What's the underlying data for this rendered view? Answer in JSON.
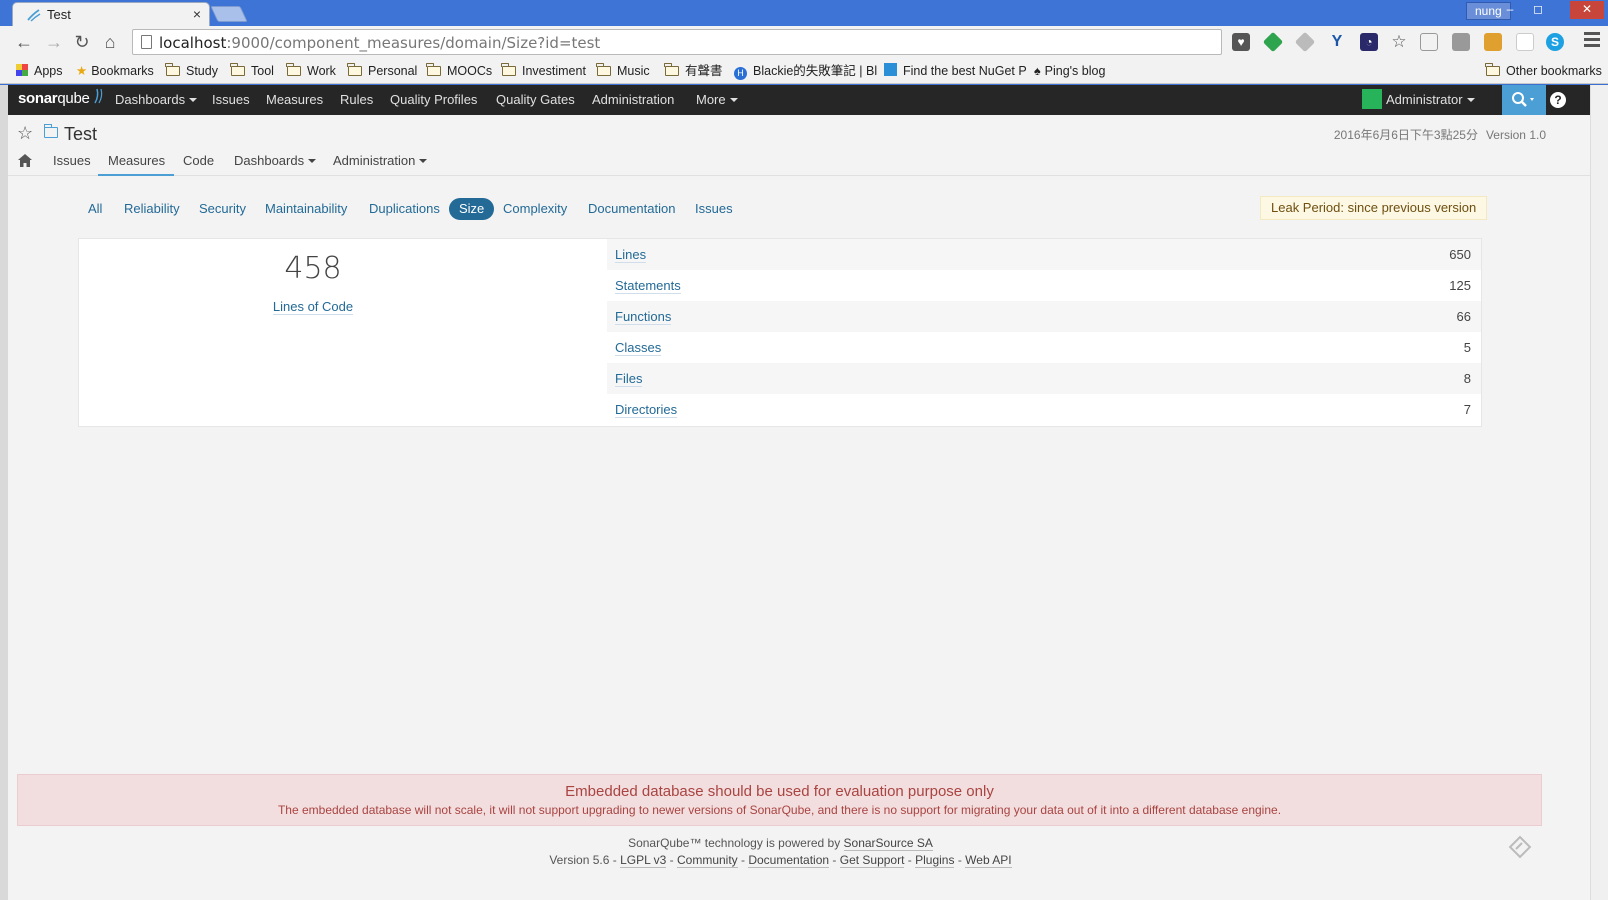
{
  "browser": {
    "tab_title": "Test",
    "tab_close": "×",
    "user_badge": "nung",
    "window_buttons": [
      "–",
      "◻",
      "✕"
    ],
    "url_host": "localhost",
    "url_path": ":9000/component_measures/domain/Size?id=test",
    "bookmarks": [
      {
        "label": "Apps",
        "icon": "apps-grid-icon"
      },
      {
        "label": "Bookmarks",
        "icon": "star-icon"
      },
      {
        "label": "Study",
        "icon": "folder-icon"
      },
      {
        "label": "Tool",
        "icon": "folder-icon"
      },
      {
        "label": "Work",
        "icon": "folder-icon"
      },
      {
        "label": "Personal",
        "icon": "folder-icon"
      },
      {
        "label": "MOOCs",
        "icon": "folder-icon"
      },
      {
        "label": "Investiment",
        "icon": "folder-icon"
      },
      {
        "label": "Music",
        "icon": "folder-icon"
      },
      {
        "label": "有聲書",
        "icon": "folder-icon"
      },
      {
        "label": "Blackie的失敗筆記 | Bl",
        "icon": "blog-h-icon"
      },
      {
        "label": "Find the best NuGet P",
        "icon": "nuget-icon"
      },
      {
        "label": "Ping's blog",
        "icon": "spade-icon"
      }
    ],
    "other_bookmarks": "Other bookmarks"
  },
  "sonar": {
    "logo_bold": "sonar",
    "logo_light": "qube",
    "nav": [
      "Dashboards",
      "Issues",
      "Measures",
      "Rules",
      "Quality Profiles",
      "Quality Gates",
      "Administration",
      "More"
    ],
    "user": "Administrator",
    "help": "?"
  },
  "component": {
    "name": "Test",
    "date": "2016年6月6日下午3點25分",
    "version": "Version 1.0",
    "tabs": [
      "Issues",
      "Measures",
      "Code",
      "Dashboards",
      "Administration"
    ],
    "active_tab": "Measures"
  },
  "domains": {
    "items": [
      "All",
      "Reliability",
      "Security",
      "Maintainability",
      "Duplications",
      "Size",
      "Complexity",
      "Documentation",
      "Issues"
    ],
    "active": "Size",
    "leak_period": "Leak Period: since previous version"
  },
  "size": {
    "main_value": "458",
    "main_label": "Lines of Code",
    "rows": [
      {
        "label": "Lines",
        "value": "650"
      },
      {
        "label": "Statements",
        "value": "125"
      },
      {
        "label": "Functions",
        "value": "66"
      },
      {
        "label": "Classes",
        "value": "5"
      },
      {
        "label": "Files",
        "value": "8"
      },
      {
        "label": "Directories",
        "value": "7"
      }
    ]
  },
  "footer": {
    "alert_title": "Embedded database should be used for evaluation purpose only",
    "alert_text": "The embedded database will not scale, it will not support upgrading to newer versions of SonarQube, and there is no support for migrating your data out of it into a different database engine.",
    "powered_prefix": "SonarQube™ technology is powered by ",
    "powered_link": "SonarSource SA",
    "version": "Version 5.6",
    "links": [
      "LGPL v3",
      "Community",
      "Documentation",
      "Get Support",
      "Plugins",
      "Web API"
    ]
  },
  "colors": {
    "sonar_nav": "#262626",
    "link_blue": "#236a97",
    "accent": "#4b9fd5",
    "alert_bg": "#f2dede",
    "alert_text": "#a94442",
    "leak_bg": "#fcf8e3"
  }
}
